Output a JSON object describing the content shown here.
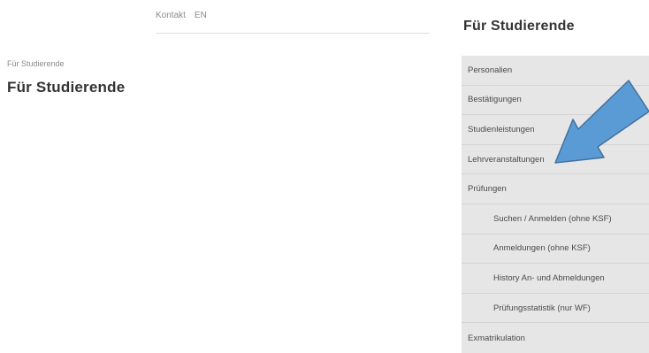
{
  "topnav": {
    "contact": "Kontakt",
    "language": "EN"
  },
  "breadcrumb": "Für Studierende",
  "page_title": "Für Studierende",
  "sidebar": {
    "title": "Für Studierende",
    "items": [
      {
        "label": "Personalien"
      },
      {
        "label": "Bestätigungen"
      },
      {
        "label": "Studienleistungen"
      },
      {
        "label": "Lehrveranstaltungen"
      },
      {
        "label": "Prüfungen"
      },
      {
        "label": "Suchen / Anmelden (ohne KSF)"
      },
      {
        "label": "Anmeldungen (ohne KSF)"
      },
      {
        "label": "History An- und Abmeldungen"
      },
      {
        "label": "Prüfungsstatistik (nur WF)"
      },
      {
        "label": "Exmatrikulation"
      }
    ]
  },
  "annotation": {
    "arrow_color": "#5b9bd5",
    "arrow_outline": "#41719c"
  }
}
